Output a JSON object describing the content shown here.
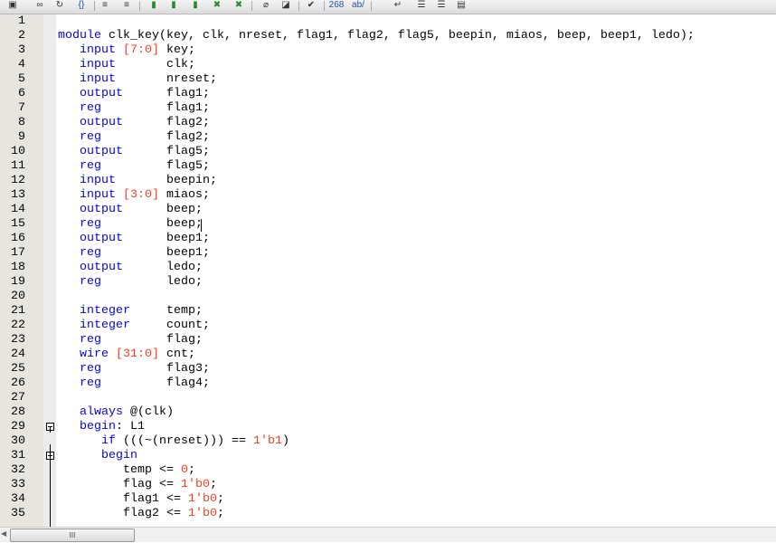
{
  "toolbar": {
    "items": [
      {
        "icon": "window-icon"
      },
      {
        "icon": "binoculars-icon"
      },
      {
        "icon": "replace-icon"
      },
      {
        "icon": "braces-icon",
        "label": "{}"
      },
      {
        "icon": "indent-icon"
      },
      {
        "icon": "outdent-icon"
      },
      {
        "icon": "bookmark-icon"
      },
      {
        "icon": "bookmark-next-icon"
      },
      {
        "icon": "bookmark-prev-icon"
      },
      {
        "icon": "bookmark-clear-icon"
      },
      {
        "icon": "bookmark-clear-all-icon"
      },
      {
        "icon": "paperclip-icon"
      },
      {
        "icon": "scroll-icon"
      },
      {
        "icon": "check-icon"
      },
      {
        "icon": "line-number-icon",
        "label": "268"
      },
      {
        "icon": "spell-icon",
        "label": "ab/"
      },
      {
        "icon": "wrap-icon"
      },
      {
        "icon": "align-icon"
      },
      {
        "icon": "align-right-icon"
      },
      {
        "icon": "text-block-icon"
      }
    ]
  },
  "editor": {
    "lines": [
      [],
      [
        [
          "kw",
          "module"
        ],
        [
          "id",
          " clk_key(key, clk, nreset, flag1, flag2, flag5, beepin, miaos, beep, beep1, ledo);"
        ]
      ],
      [
        [
          "id",
          "   "
        ],
        [
          "kw",
          "input"
        ],
        [
          "id",
          " "
        ],
        [
          "num",
          "[7:0]"
        ],
        [
          "id",
          " key;"
        ]
      ],
      [
        [
          "id",
          "   "
        ],
        [
          "kw",
          "input"
        ],
        [
          "id",
          "       clk;"
        ]
      ],
      [
        [
          "id",
          "   "
        ],
        [
          "kw",
          "input"
        ],
        [
          "id",
          "       nreset;"
        ]
      ],
      [
        [
          "id",
          "   "
        ],
        [
          "kw",
          "output"
        ],
        [
          "id",
          "      flag1;"
        ]
      ],
      [
        [
          "id",
          "   "
        ],
        [
          "kw",
          "reg"
        ],
        [
          "id",
          "         flag1;"
        ]
      ],
      [
        [
          "id",
          "   "
        ],
        [
          "kw",
          "output"
        ],
        [
          "id",
          "      flag2;"
        ]
      ],
      [
        [
          "id",
          "   "
        ],
        [
          "kw",
          "reg"
        ],
        [
          "id",
          "         flag2;"
        ]
      ],
      [
        [
          "id",
          "   "
        ],
        [
          "kw",
          "output"
        ],
        [
          "id",
          "      flag5;"
        ]
      ],
      [
        [
          "id",
          "   "
        ],
        [
          "kw",
          "reg"
        ],
        [
          "id",
          "         flag5;"
        ]
      ],
      [
        [
          "id",
          "   "
        ],
        [
          "kw",
          "input"
        ],
        [
          "id",
          "       beepin;"
        ]
      ],
      [
        [
          "id",
          "   "
        ],
        [
          "kw",
          "input"
        ],
        [
          "id",
          " "
        ],
        [
          "num",
          "[3:0]"
        ],
        [
          "id",
          " miaos;"
        ]
      ],
      [
        [
          "id",
          "   "
        ],
        [
          "kw",
          "output"
        ],
        [
          "id",
          "      beep;"
        ]
      ],
      [
        [
          "id",
          "   "
        ],
        [
          "kw",
          "reg"
        ],
        [
          "id",
          "         beep;"
        ]
      ],
      [
        [
          "id",
          "   "
        ],
        [
          "kw",
          "output"
        ],
        [
          "id",
          "      beep1;"
        ]
      ],
      [
        [
          "id",
          "   "
        ],
        [
          "kw",
          "reg"
        ],
        [
          "id",
          "         beep1;"
        ]
      ],
      [
        [
          "id",
          "   "
        ],
        [
          "kw",
          "output"
        ],
        [
          "id",
          "      ledo;"
        ]
      ],
      [
        [
          "id",
          "   "
        ],
        [
          "kw",
          "reg"
        ],
        [
          "id",
          "         ledo;"
        ]
      ],
      [],
      [
        [
          "id",
          "   "
        ],
        [
          "kw",
          "integer"
        ],
        [
          "id",
          "     temp;"
        ]
      ],
      [
        [
          "id",
          "   "
        ],
        [
          "kw",
          "integer"
        ],
        [
          "id",
          "     count;"
        ]
      ],
      [
        [
          "id",
          "   "
        ],
        [
          "kw",
          "reg"
        ],
        [
          "id",
          "         flag;"
        ]
      ],
      [
        [
          "id",
          "   "
        ],
        [
          "kw",
          "wire"
        ],
        [
          "id",
          " "
        ],
        [
          "num",
          "[31:0]"
        ],
        [
          "id",
          " cnt;"
        ]
      ],
      [
        [
          "id",
          "   "
        ],
        [
          "kw",
          "reg"
        ],
        [
          "id",
          "         flag3;"
        ]
      ],
      [
        [
          "id",
          "   "
        ],
        [
          "kw",
          "reg"
        ],
        [
          "id",
          "         flag4;"
        ]
      ],
      [],
      [
        [
          "id",
          "   "
        ],
        [
          "kw",
          "always"
        ],
        [
          "id",
          " @(clk)"
        ]
      ],
      [
        [
          "id",
          "   "
        ],
        [
          "kw",
          "begin"
        ],
        [
          "id",
          ": L1"
        ]
      ],
      [
        [
          "id",
          "      "
        ],
        [
          "kw",
          "if"
        ],
        [
          "id",
          " (((~(nreset))) == "
        ],
        [
          "num",
          "1'b1"
        ],
        [
          "id",
          ")"
        ]
      ],
      [
        [
          "id",
          "      "
        ],
        [
          "kw",
          "begin"
        ]
      ],
      [
        [
          "id",
          "         temp <= "
        ],
        [
          "num",
          "0"
        ],
        [
          "id",
          ";"
        ]
      ],
      [
        [
          "id",
          "         flag <= "
        ],
        [
          "num",
          "1'b0"
        ],
        [
          "id",
          ";"
        ]
      ],
      [
        [
          "id",
          "         flag1 <= "
        ],
        [
          "num",
          "1'b0"
        ],
        [
          "id",
          ";"
        ]
      ],
      [
        [
          "id",
          "         flag2 <= "
        ],
        [
          "num",
          "1'b0"
        ],
        [
          "id",
          ";"
        ]
      ]
    ]
  },
  "scrollbar": {
    "thumb_grip": "III"
  }
}
